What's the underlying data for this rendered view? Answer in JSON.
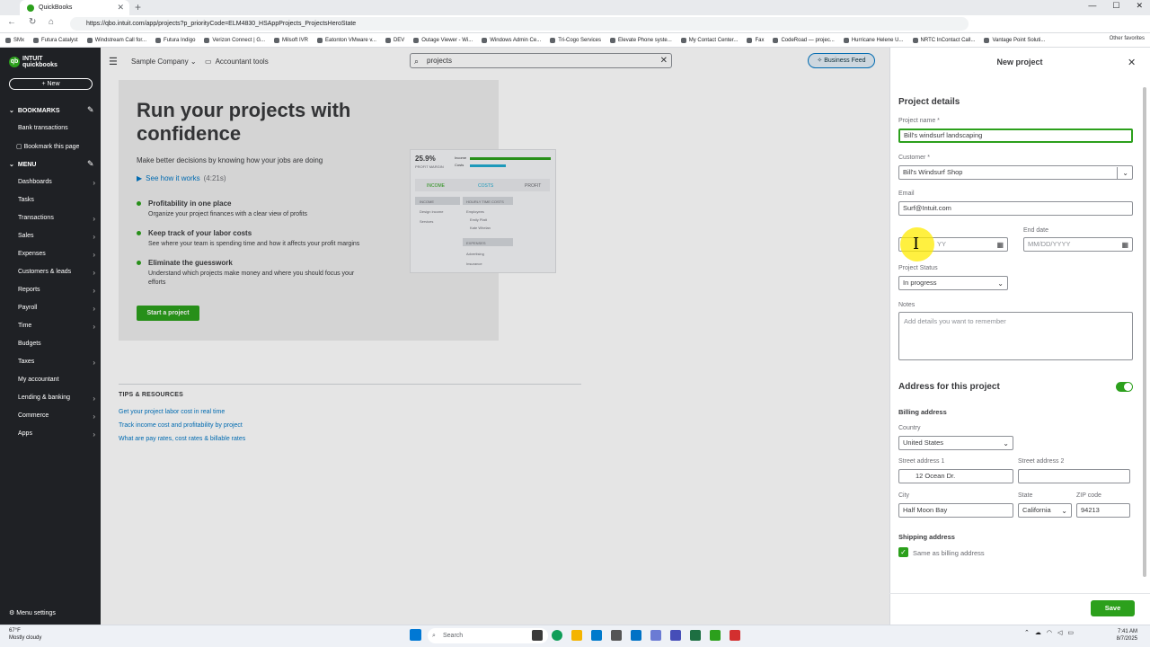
{
  "browser": {
    "tab_title": "QuickBooks",
    "url": "https://qbo.intuit.com/app/projects?p_priorityCode=ELM4830_HSAppProjects_ProjectsHeroState",
    "bookmarks": [
      "SMx",
      "Futura Catalyst",
      "Windstream Call for...",
      "Futura Indigo",
      "Verizon Connect | G...",
      "Milsoft IVR",
      "Eatonton VMware v...",
      "DEV",
      "Outage Viewer - Wi...",
      "Windows Admin Ce...",
      "Tri-Cogo Services",
      "Elevate Phone syste...",
      "My Contact Center...",
      "Fax",
      "CodeRoad — projec...",
      "Hurricane Helene U...",
      "NRTC InContact Call...",
      "Vantage Point Soluti..."
    ],
    "other_favorites": "Other favorites"
  },
  "leftnav": {
    "logo_line1": "INTUIT",
    "logo_line2": "quickbooks",
    "new_label": "+ New",
    "bookmarks_header": "BOOKMARKS",
    "bookmark_items": [
      "Bank transactions",
      "Bookmark this page"
    ],
    "menu_header": "MENU",
    "menu_items": [
      {
        "label": "Dashboards",
        "chevron": true
      },
      {
        "label": "Tasks",
        "chevron": false
      },
      {
        "label": "Transactions",
        "chevron": true
      },
      {
        "label": "Sales",
        "chevron": true
      },
      {
        "label": "Expenses",
        "chevron": true
      },
      {
        "label": "Customers & leads",
        "chevron": true
      },
      {
        "label": "Reports",
        "chevron": true
      },
      {
        "label": "Payroll",
        "chevron": true
      },
      {
        "label": "Time",
        "chevron": true
      },
      {
        "label": "Budgets",
        "chevron": false
      },
      {
        "label": "Taxes",
        "chevron": true
      },
      {
        "label": "My accountant",
        "chevron": false
      },
      {
        "label": "Lending & banking",
        "chevron": true
      },
      {
        "label": "Commerce",
        "chevron": true
      },
      {
        "label": "Apps",
        "chevron": true
      }
    ],
    "menu_settings": "Menu settings"
  },
  "topbar": {
    "company": "Sample Company",
    "accountant_tools": "Accountant tools",
    "search_value": "projects",
    "business_feed": "Business Feed"
  },
  "hero": {
    "title": "Run your projects with confidence",
    "subtitle": "Make better decisions by knowing how your jobs are doing",
    "video_link": "See how it works",
    "video_duration": "(4:21s)",
    "features": [
      {
        "title": "Profitability in one place",
        "desc": "Organize your project finances with a clear view of profits"
      },
      {
        "title": "Keep track of your labor costs",
        "desc": "See where your team is spending time and how it affects your profit margins"
      },
      {
        "title": "Eliminate the guesswork",
        "desc": "Understand which projects make money and where you should focus your efforts"
      }
    ],
    "start_button": "Start a project",
    "illus": {
      "margin_value": "25.9%",
      "margin_label": "PROFIT MARGIN",
      "income_legend": "Income",
      "costs_legend": "Costs",
      "col_income": "INCOME",
      "col_costs": "COSTS",
      "col_profit": "PROFIT",
      "income_rows": [
        "INCOME",
        "Design income",
        "Services"
      ],
      "hourly_header": "HOURLY TIME COSTS",
      "hourly_rows": [
        "Employees",
        "Emily Platt",
        "Kate Whelan"
      ],
      "expenses_header": "EXPENSES",
      "expenses_rows": [
        "Advertising",
        "Insurance"
      ]
    }
  },
  "tips": {
    "header": "TIPS & RESOURCES",
    "links": [
      "Get your project labor cost in real time",
      "Track income cost and profitability by project",
      "What are pay rates, cost rates & billable rates"
    ]
  },
  "panel": {
    "title": "New project",
    "details_header": "Project details",
    "project_name_label": "Project name *",
    "project_name_value": "Bill's windsurf landscaping",
    "customer_label": "Customer *",
    "customer_value": "Bill's Windsurf Shop",
    "email_label": "Email",
    "email_value": "Surf@Intuit.com",
    "start_date_placeholder": "YY",
    "end_date_label": "End date",
    "end_date_placeholder": "MM/DD/YYYY",
    "status_label": "Project Status",
    "status_value": "In progress",
    "notes_label": "Notes",
    "notes_placeholder": "Add details you want to remember",
    "address_header": "Address for this project",
    "address_toggle_on": true,
    "billing_header": "Billing address",
    "country_label": "Country",
    "country_value": "United States",
    "street1_label": "Street address 1",
    "street1_value": "12 Ocean Dr.",
    "street2_label": "Street address 2",
    "street2_value": "",
    "city_label": "City",
    "city_value": "Half Moon Bay",
    "state_label": "State",
    "state_value": "California",
    "zip_label": "ZIP code",
    "zip_value": "94213",
    "shipping_header": "Shipping address",
    "same_as_billing": "Same as billing address",
    "save_button": "Save"
  },
  "taskbar": {
    "temp": "67°F",
    "weather": "Mostly cloudy",
    "search": "Search",
    "time": "7:41 AM",
    "date": "8/7/2025"
  },
  "colors": {
    "accent": "#2ca01c",
    "link": "#0077c5",
    "nav_bg": "#1f2125"
  }
}
